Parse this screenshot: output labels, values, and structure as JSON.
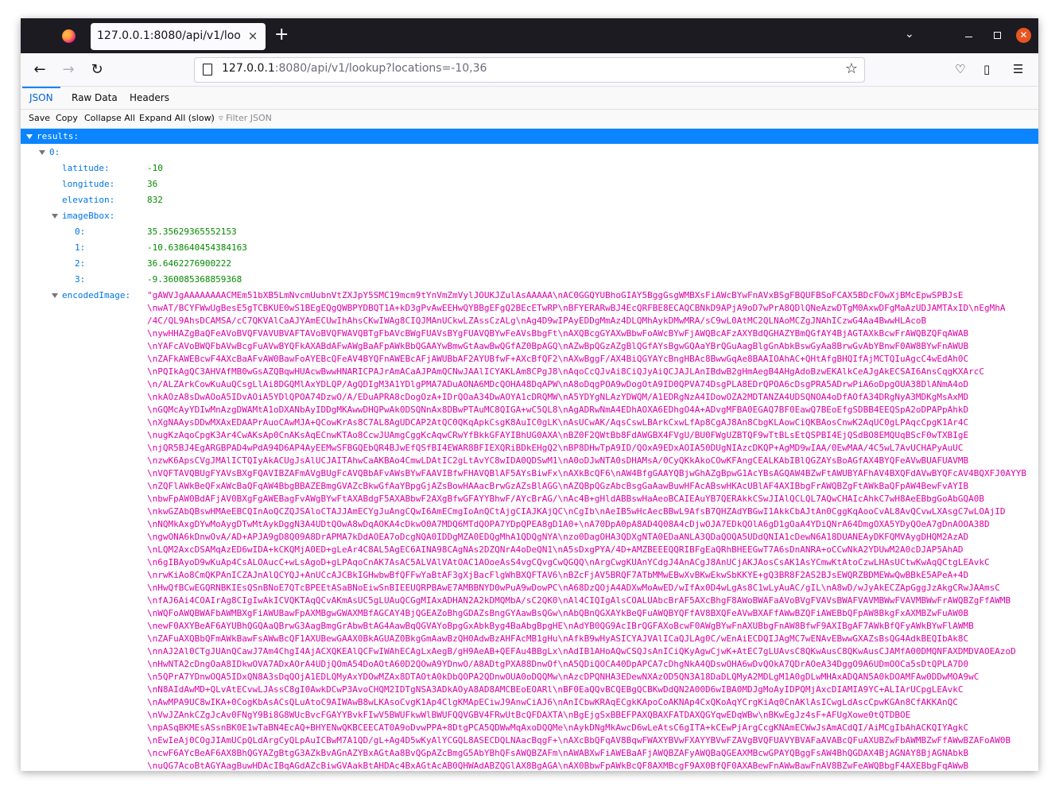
{
  "browser": {
    "tab_title": "127.0.0.1:8080/api/v1/lookup?locations=-10,36",
    "tab_close": "×",
    "new_tab": "+",
    "url_host": "127.0.0.1",
    "url_rest": ":8080/api/v1/lookup?locations=-10,36"
  },
  "viewer": {
    "tabs": [
      "JSON",
      "Raw Data",
      "Headers"
    ],
    "toolbar": {
      "save": "Save",
      "copy": "Copy",
      "collapse_all": "Collapse All",
      "expand_all": "Expand All (slow)",
      "filter_placeholder": "Filter JSON"
    }
  },
  "json": {
    "results_key": "results:",
    "item_key": "0:",
    "latitude_key": "latitude:",
    "latitude": "-10",
    "longitude_key": "longitude:",
    "longitude": "36",
    "elevation_key": "elevation:",
    "elevation": "832",
    "bbox_key": "imageBbox:",
    "bbox": [
      {
        "key": "0:",
        "value": "35.35629365552153"
      },
      {
        "key": "1:",
        "value": "-10.638640454384163"
      },
      {
        "key": "2:",
        "value": "36.6462276900222"
      },
      {
        "key": "3:",
        "value": "-9.360085368859368"
      }
    ],
    "encoded_key": "encodedImage:",
    "encoded_lines": [
      "\"gAWVJgAAAAAAAACMEm51bXB5LmNvcmUubnVtZXJpY5SMC19mcm9tYnVmZmVylJOUKJZulAsAAAAA\\nAC0GGQYUBhoGIAY5BggGsgWMBXsFiAWcBYwFnAVxBSgFBQUFBSoFCAX5BDcFOwXjBMcEpwSPBJsE",
      "\\nwAT/BCYFWwUgBesE5gTCBKUE0wS1BEgEQgQWBPYDBQT1A+kD3gPvAwEEHwQYBBgEFgQ2BEcETwRP\\nBFYERARwBJ4EcQRFBE8ECAQCBNkD9APjA9oD7wPrA8QDlQNeAzwDTgM0AxwDFgMaAzUDJAMTAxID\\nEgMhA",
      "/4C/QL9AhsDCAMSA/cC7QKVAlCaAJYAmECUwIhAhsCKwIWAg8CIQJMAnUCkwLZAssCzALg\\nAg4D9wIPAyEDDgMmAz4DLQMhAykDMwMRA/sC9wL0AtMC2QLNAoMCZgJNAhICzwG4Aa4BwwHLAcoB",
      "\\nywHHAZgBaQFeAVoBVQFVAVUBVAFTAVoBVQFWAVQBTgFbAVcBWgFUAVsBYgFUAVQBYwFeAVsBbgFt\\nAXQBcgGYAXwBbwFoAWcBYwFjAWQBcAFzAXYBdQGHAZYBmQGfAY4BjAGTAXkBcwFrAWQBZQFqAWAB",
      "\\nYAFcAVoBWQFbAVwBcgFuAVwBYQFkAXABdAFwAWgBaAFpAWkBbQGAAYwBmwGtAawBwQGfAZ0BpAGQ\\nAZwBpQGzAZgBlQGfAYsBgwGQAaYBrQGuAagBlgGnAbkBswGyAa8BrwGvAbYBnwF0AW8BYwFnAWUB",
      "\\nZAFkAWEBcwF4AXcBaAFvAW0BawFoAYEBcQFeAV4BYQFnAWEBcAFjAWUBbAF2AYUBfwF+AXcBfQF2\\nAXwBggF/AX4BiQGYAYcBngHBAc8BwwGqAe8BAAIOAhAC+QHtAfgBHQIfAjMCTQIuAgcC4wEdAh0C",
      "\\nPQIkAgQC3AHVAfMB0wGsAZQBqwHUAcwBwwHNARICPAJrAmACaAJPAmQCNwJAAlICYAKLAm8CPgJ8\\nAqoCcQJvAi8CiQJyAiQCJAJLAnIBdwB2gHmAegB4AHgAdoBzwEKAlkCeAJgAkECSAI6AnsCqgKXArcC",
      "\\n/ALZArkCowKuAuQCsgLlAi8DGQMlAxYDLQP/AgQDIgM3A1YDlgPMA7ADuAONA6MDcQOHA48DqAPW\\nA8oDqgPOA9wDogOtA9ID0QPVA74DsgPLA8EDrQPOA6cDsgPRA5ADrwPiA6oDpgOUA38DlANmA4oD",
      "\\nkAOzA8sDwAOoA5IDvAOiA5YDlQPOA74DzwO/A/EDuAPRA8cDogOzA+IDrQOaA34DwAOYA1cDRQMW\\nA5YDYgNLAzYDWQM/A1EDRgNzA4IDowOZA2MDTANZA4UDSQNOA4oDfAOfA34DRgNyA3MDKgMsAxMD",
      "\\nGQMcAyYDIwMnAzgDWAMtA1oDXANbAyIDDgMKAwwDHQPwAk0DSQNnAx8DBwPTAuMC8QIGA+wC5QL8\\nAgADRwNmA4EDhAOXA6EDhgO4A+ADvgMFBA0EGAQ7BF0EawQ7BEoEfgSDBB4EEQSpA2oDPAPpAhkD",
      "\\nXgNAAysDDwMXAxEDAAPrAuoCAwMJA+QCowKrAs8C7AL8AgUDCAP2AtQC0QKqApkCsgK8AuIC0gLK\\nAsUCwAK/AqsCswLBArkCxwLfAp8CgAJ8An8CbgKLAowCiQKBAosCnwK2AqUC0gLPAqcCpgK1Ar4C",
      "\\nugKzAqoCpgK3Ar4CwAKsAp0CnAKsAqECnwKTAo8CcwJUAmgCggKcAqwCRwYfBkkGFAYIBhUG0AXA\\nBZ0F2QWtBb8FdAWGBX4FVgU/BU0FWgUZBTQF9wTtBLsEtQSPBI4EjQSdBO8EMQUqBScF0wTXBIgE",
      "\\njQR5BJ4EgARGBPAD4wPdA94D6AP4AyEEMwSFBGQEbQR4BJwEfQSfBI4EWAR8BFIEXQRiBDkEHgQ2\\nBP8DHwTpA9ID/QOxA9EDxAOIA50DUgNIAzcDKQP+AgMD9wIAA/0EwMAA/4C5wL7AvUCHAPyAuUC",
      "\\nzwK6ApsCVgJMAlICTQIyAkACUgJsAlUCJAITAhwCaAKBAo4CmwLDAtIC2gLtAvYC8wIDA0QDSwM1\\nA0oDJwNTA0sDHAMsA/0CyQKkAkoCOwKFAngCEALKAbIBlQGZAYsBoAGfAX4BYQFeAVwBUAFUAVMB",
      "\\nVQFTAVQBUgFYAVsBXgFQAVIBZAFmAVgBUgFcAVQBbAFvAWsBYwFAAVIBfwFHAVQBlAF5AYsBiwFx\\nAXkBcQF6\\nAW4BfgGAAYQBjwGhAZgBpwG1AcYBsAGQAW4BZwFtAWUBYAFhAV4BXQFdAVwBYQFcAV4BQXFJ0AYYB",
      "\\nZQFlAWkBeQFxAWcBaQFqAW4BbgBBAZEBmgGVAZcBkwGfAaYBpgGjAZsBowHAAacBrwGzAZsBlAGG\\nAZQBpQGzAbcBsgGaAawBuwHFAcABswHKAcUBlAF4AXIBbgFrAWQBZgFtAWkBaQFpAW4BewFvAYIB",
      "\\nbwFpAW0BdAFjAV0BXgFgAWEBagFvAWgBYwFtAXABdgF5AXABbwF2AXgBfwGFAYYBhwF/AYcBrAG/\\nAc4B+gHldABBswHaAeoBCAIEAuYB7QERAkkCSwJIAlQCLQL7AQwCHAIcAhkC7wH8AeEBbgGoAbGQA0B",
      "\\nkwGZAbQBswHMAeEBCQInAoQCZQJSAloCTAJJAmECYgJuAngCQwI6AmECmgIoAnQCtAjgCIAJKAjQC\\nCgIb\\nAeIB5wHcAecBBwL9AfsB7QHZAdYBGwI1AkkCbAJtAn0CggKqAooCvAL8AvQCvwLXAsgC7wLOAjID",
      "\\nNQMkAxgDYwMoAygDTwMtAykDggN3A4UDtQOwA8wDqAOKA4cDkwO0A7MDQ6MTdQOPA7YDpQPEA8gD1A0+\\nA70DpA0pA8AD4Q08A4cDjwOJA7EDkQOlA6gD1gOaA4YDiQNrA64DmgOXA5YDyQOeA7gDnAOOA38D",
      "\\ngwONA6kDnwOvA/AD+APJA9gD8Q09A8DrAPMA7kDdAOEA7oDcgNQA0IDDgMZA0EDQgMhA1QDQgNYA\\nzo0DagOHA3QDXgNTA0EDaANLA3QDaQOQA5UDdQNIA1cDewN6A18DUANEAyDKFQMVAygDHQM2AzAD",
      "\\nLQM2AxcDSAMqAzED6wIDA+kCKQMjA0ED+gLeAr4C8AL5AgEC6AINA98CAgNAs2DZQNrA4oDeQN1\\nA5sDxgPYA/4D+AMZBEEEQQRIBFgEaQRhBHEEGwT7A6sDnANRA+oCCwNkA2YDUwM2A0cDJAP5AhAD",
      "\\n6gIBAyoD9wKuAp4CsALOAucC+wLsAgoD+gLPAqoCnAK7AsAC5ALVAlVAtOAC1AOoeAsS4vgCQvgCwQGQQ\\nArgCwgKUAnYCdgJ4AnACgJ8AnUCjAKJAosCsAK1AsYCmwKtAtoCzwLHAsUCtwKwAqQCtgLEAvkC",
      "\\nrwKiAo8CmQKPAnICZAJnAlQCYQJ+AnUCcAJCBkIGHwbwBfQFFwYaBtAF3gXjBacFlgWhBXQFTAV6\\nBZcFjAV5BRQF7ATbMMwEBwXvBKwEkwSbKKYE+gQ3BR8F2AS2BJsEWQRZBDMEWwQwBBkE5APeA+4D",
      "\\nHwQfBCwEGQRNBKIEsQSnBNoE7QTcBPEEtASaBNoEiwSnBIEEUQRPBAwE7AMBBNYD0wPuA9wDowPC\\nA68DzQOjA4ADXwMoAwED/wIfAx0D4wLgAs8C1wLyAuAC/gIL\\nA8wD/wJyAkECZApGggJzAkgCRwJAAmsC",
      "\\nfAJ6Ai4COAIrAg8CIgIwAkICVQKTAqQCvAKmAsUC5gLUAuQCGgMIAxADHAN2A2kDMQMbA/sC2QK0\\nAl4CIQIgAlsCOALUAbcBrAF5AXcBhgF8AWoBWAFaAVoBVgFVAVsBWAFVAVMBWwFVAVMBWwFrAWQBZgFfAWMB",
      "\\nWQFoAWQBWAFbAWMBXgFiAWUBawFpAXMBgwGWAXMBfAGCAY4BjQGEAZoBhgGDAZsBngGYAawBsQGw\\nAbQBnQGXAYkBeQFuAWQBYQFfAV8BXQFeAVwBXAFfAWwBZQFiAWEBbQFpAW8BkgFxAXMBZwFuAW0B",
      "\\newF0AXYBeAF6AYUBhQGQAaQBrwG3AagBmgGrAbwBtAG4AawBqQGVAYoBpgGxAbkByg4BaAbgBpgHE\\nAdYB0QG9AcIBrQGFAXoBcwF0AWgBYwFnAXUBbgFnAW8BfwF9AXIBgAF7AWkBfQFyAWkBYwFlAWMB",
      "\\nZAFuAXQBbQFmAWkBawFsAWwBcQF1AXUBewGAAX0BkAGUAZ0BkgGmAawBzQH0AdwBzAHFAcMB1gHu\\nAfkB9wHyASICYAJVAlICaQJLAg0C/wEnAiECDQIJAgMC7wENAvEBwwGXAZsBsQG4AdkBEQIbAk8C",
      "\\nnAJ2Al0CTgJUAnQCawJ7Am4ChgI4AjACXQKEAlQCFwIWAhECAgLxAegB/gH9AeAB+QEFAu4BBgLx\\nAdIB1AHoAQwCSQJsAnICiQKyAgwCjwK+AtEC7gLUAvsC8QKwAusC8QKwAusCJAMfA00DMQNFAXDMDVAOEAzoD",
      "\\nHwNTA2cDngOaA8IDkwOVA7ADxAOrA4UDjQOmA54DoAOtA60D2QOwA9YDnwO/A8ADtgPXA88DnwOf\\nA5QDiQOCA40DpAPCA7cDhgNkA4QDswOHA6wDvQOkA7QDrAOeA34DggO9A6UDmOOCa5sDtQPLA7D0",
      "\\n5QPrA7YDnwOQA5IDxQN8A3sDqQOjA1EDLQMyAxYDOwMZAx8DTAOtA0kDbQOPA2QDnwOUA0oDQQMw\\nAzcDPQNHA3EDewNXAzOD5QN3A18DaDLQMyA2MDLgM1A0gDLwMHAxADQAN5A0kDOAMFAw0DDwMOA9wC",
      "\\nN8AIdAwMD+QLvAtECvwLJAssC8gI0AwkDCwP3AvoCHQM2IDTgNSA3ADkAOyA8AD8AMCBEoEOARl\\nBF0EaQQvBCQEBgQCBKwDdQN2A00D6wIBA0MDJgMoAyIDPQMjAxcDIAMIA9YC+ALIArUCpgLEAvkC",
      "\\nAwMPA9UC8wIKA+0CogKbAsACsQLuAtoC9AIWAwB8wLKAsoCvgK1Ap4ClgKMApECiwJ9AnwCiAJ6\\nAnICbwKRAqECgkKApoCoAKNAp4CxQKoAqYCrgKiAq0CnAKlAsICwgLdAscCpwKGAn8CfAKKAnQC",
      "\\nVwJZAnkCZgJcAv0FNgY9Bi8G8WUcBvcFGAYYBvkFIwV5BWUFkwWlBWUFQQVGBV4FRwUtBcQFDAXTA\\nBgEjgSxBBEFPAXQBAXFATDAXQGYqwEDqWBw\\nBKwEgJz4sF+AFUgXowe0tQTDBOE",
      "\\npASqBKMEsASsnBK0E1wTaBN4EcAQ+BHYENwQKBCEECAT0A9oDvwPPA+8DtgPCA5QDWwMqAxoDQQMe\\nAykDNgMkAwcD6wLeAtsC6gITA+kCEwPjArgCcgKNAmECWwJsAmACdQI/AiMCgIbAhACKQIYAgkC",
      "\\nEwIeAj0COgJIAmUCpQLdArgCyQLpAuICBwM7A1QD/gL+Ag4D5wKyAlYCGQL8ASECDQLNAacBqgF+\\nAXcBbQFqAV8BqwFWAXYBVwFXAYYBVwFZAVgBVQFUAVYBVAFaAVABcQFuAXUBZwFbAWMBZwFfAWwBZAFoAW0B",
      "\\ncwF6AYcBeAF6AX8BhQGYAZgBtgG3AZkBvAGnAZYBxAGtAa8BvQGpAZcBmgG5AbYBhQFsAWQBZAFm\\nAWABXwFiAWEBaAFjAWQBZAFyAWQBaQGEAXMBcwGPAYQBggFsAW4BhQGDAX4BjAGNAY8BjAGNAbkB",
      "\\nuQG7AcoBtAGYAagBuwHDAcIBqAGdAZcBiwGVAakBtAHDAc4BxAGtAcAB0QHWAdABZQGlAX8BgAGA\\nAX0BbwFpAWkBcQF8AXMBcgF9AX0BfQF0AXABewFnAWwBawFnAV8BZwFeAWQBbgF4AXEBbgFqAWwB"
    ]
  }
}
